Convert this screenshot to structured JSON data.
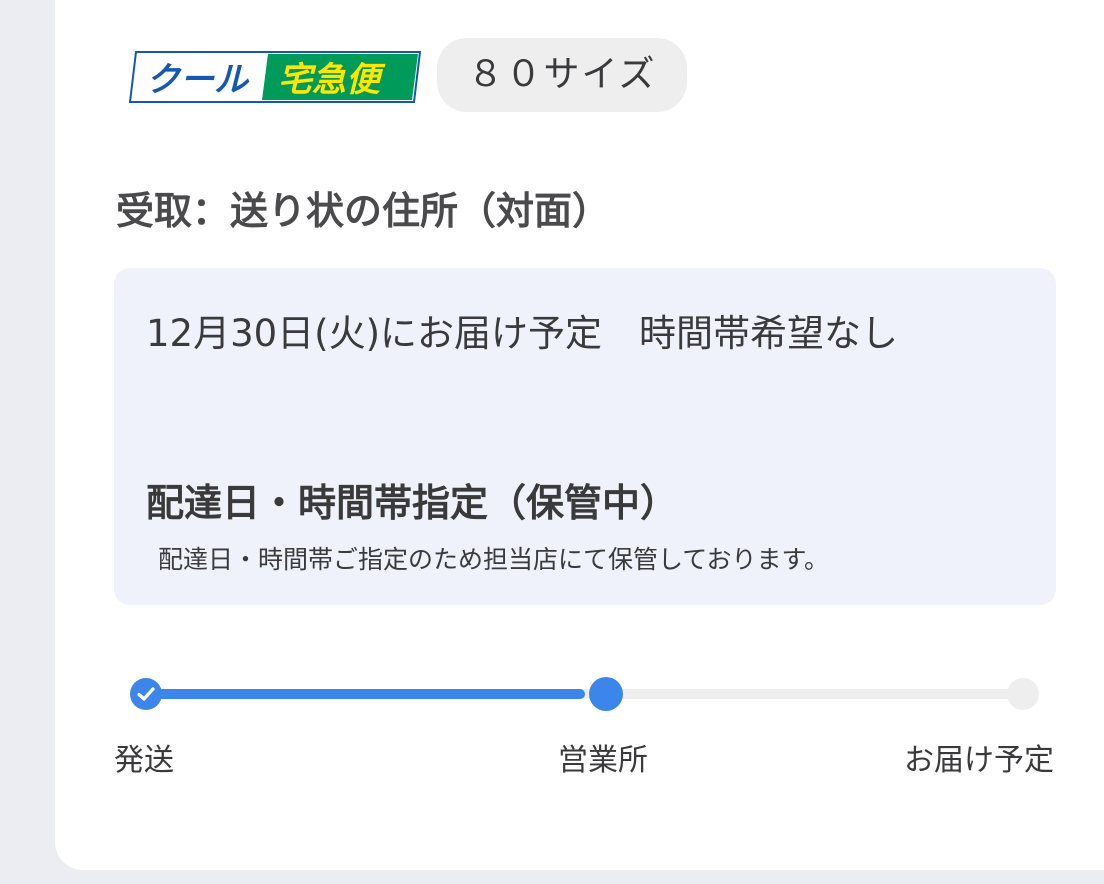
{
  "service": {
    "logo_left": "クール",
    "logo_right": "宅急便",
    "size": "８０サイズ"
  },
  "receive": {
    "text": "受取：送り状の住所（対面）"
  },
  "delivery": {
    "line": "12月30日(火)にお届け予定　時間帯希望なし",
    "status_title": "配達日・時間帯指定（保管中）",
    "status_note": "配達日・時間帯ご指定のため担当店にて保管しております。"
  },
  "progress": {
    "current_step": 2,
    "total_steps": 3,
    "fill_fraction": 0.5,
    "steps": [
      "発送",
      "営業所",
      "お届け予定"
    ]
  },
  "colors": {
    "accent": "#3c86eb",
    "logo_blue": "#1558b0",
    "logo_green": "#009a5a",
    "logo_yellow": "#ffe600"
  }
}
